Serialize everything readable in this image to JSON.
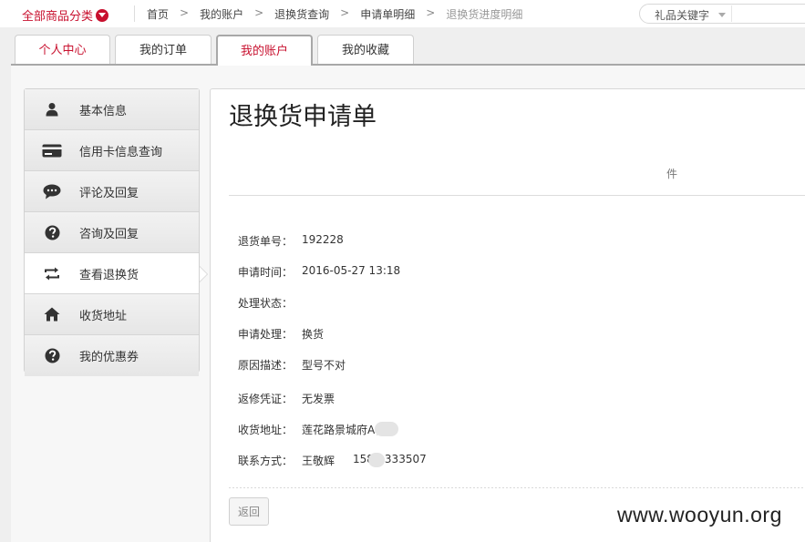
{
  "header": {
    "all_categories": "全部商品分类",
    "breadcrumb": [
      "首页",
      "我的账户",
      "退换货查询",
      "申请单明细",
      "退换货进度明细"
    ],
    "breadcrumb_sep": ">",
    "search_label": "礼品关键字"
  },
  "tabs": [
    {
      "label": "个人中心",
      "state": "red"
    },
    {
      "label": "我的订单",
      "state": "normal"
    },
    {
      "label": "我的账户",
      "state": "active"
    },
    {
      "label": "我的收藏",
      "state": "normal"
    }
  ],
  "sidebar": {
    "items": [
      {
        "label": "基本信息",
        "icon": "user-icon"
      },
      {
        "label": "信用卡信息查询",
        "icon": "credit-card-icon"
      },
      {
        "label": "评论及回复",
        "icon": "comment-icon"
      },
      {
        "label": "咨询及回复",
        "icon": "question-icon"
      },
      {
        "label": "查看退换货",
        "icon": "exchange-icon",
        "active": true
      },
      {
        "label": "收货地址",
        "icon": "home-icon"
      },
      {
        "label": "我的优惠券",
        "icon": "coupon-question-icon"
      }
    ]
  },
  "main": {
    "title": "退换货申请单",
    "column_header": "件",
    "fields": [
      {
        "label": "退货单号：",
        "value": "192228"
      },
      {
        "label": "申请时间：",
        "value": "2016-05-27 13:18"
      },
      {
        "label": "处理状态：",
        "value": ""
      },
      {
        "label": "申请处理：",
        "value": "换货"
      },
      {
        "label": "原因描述：",
        "value": "型号不对"
      },
      {
        "label": "返修凭证：",
        "value": "无发票"
      },
      {
        "label": "收货地址：",
        "value": "莲花路景城府A栋"
      },
      {
        "label": "联系方式：",
        "value": "王敬辉",
        "value2_prefix": "158",
        "value2_suffix": "333507"
      }
    ],
    "back_button": "返回"
  },
  "watermark": "www.wooyun.org",
  "colors": {
    "brand_red": "#c8102e"
  }
}
